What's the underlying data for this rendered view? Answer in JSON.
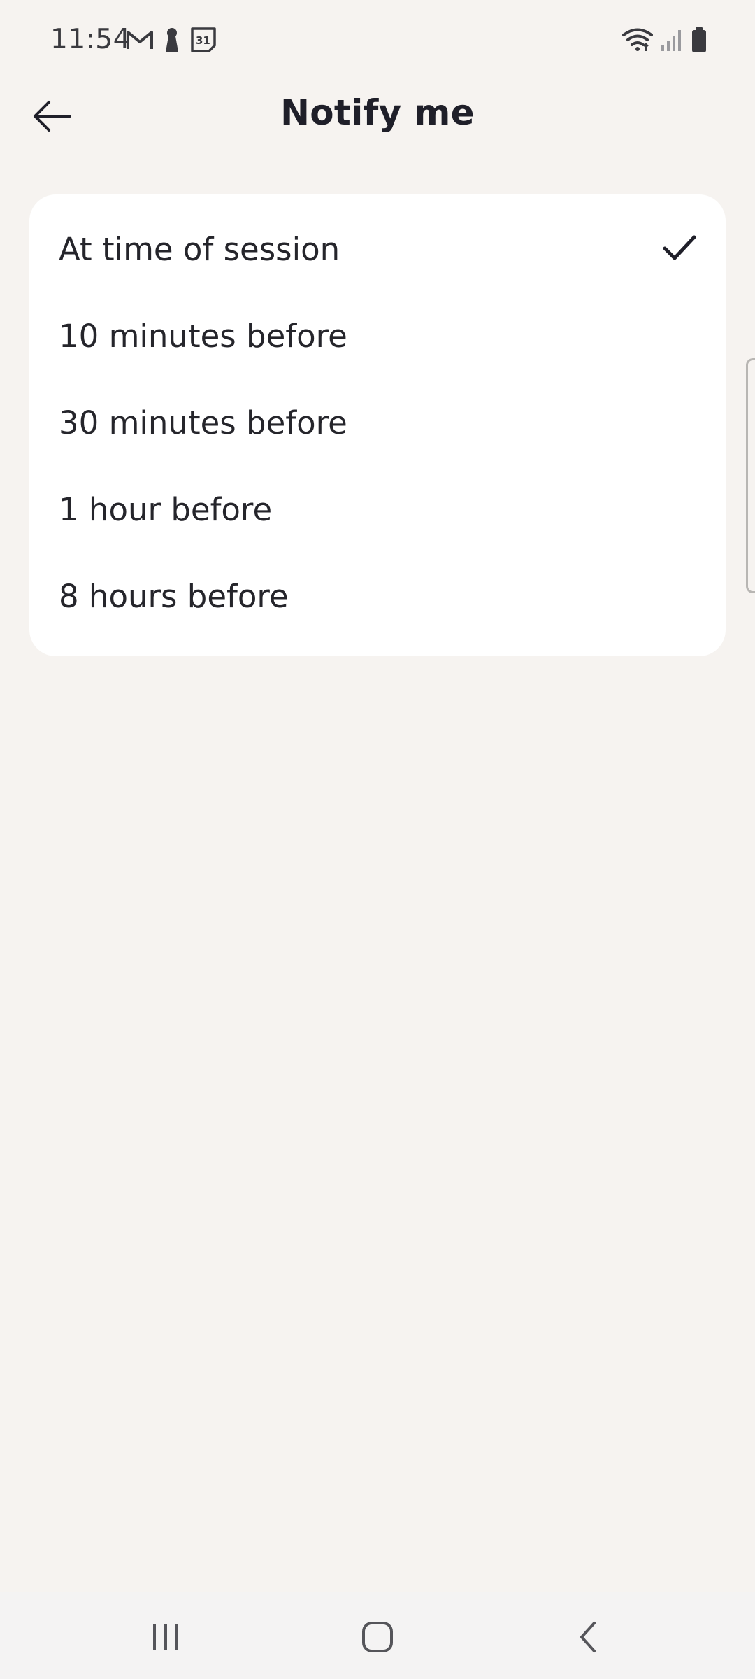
{
  "status_bar": {
    "time": "11:54",
    "left_icons": [
      "gmail-icon",
      "keyhole-icon",
      "calendar-icon"
    ],
    "calendar_day": "31",
    "right_icons": [
      "wifi-icon",
      "signal-icon",
      "battery-icon"
    ]
  },
  "header": {
    "title": "Notify me",
    "back_icon": "back-arrow-icon"
  },
  "options": [
    {
      "label": "At time of session",
      "selected": true
    },
    {
      "label": "10 minutes before",
      "selected": false
    },
    {
      "label": "30 minutes before",
      "selected": false
    },
    {
      "label": "1 hour before",
      "selected": false
    },
    {
      "label": "8 hours before",
      "selected": false
    }
  ],
  "nav_bar": {
    "icons": [
      "recents-icon",
      "home-icon",
      "back-icon"
    ]
  },
  "colors": {
    "background": "#f6f3f0",
    "card": "#ffffff",
    "text": "#1e1e24"
  }
}
